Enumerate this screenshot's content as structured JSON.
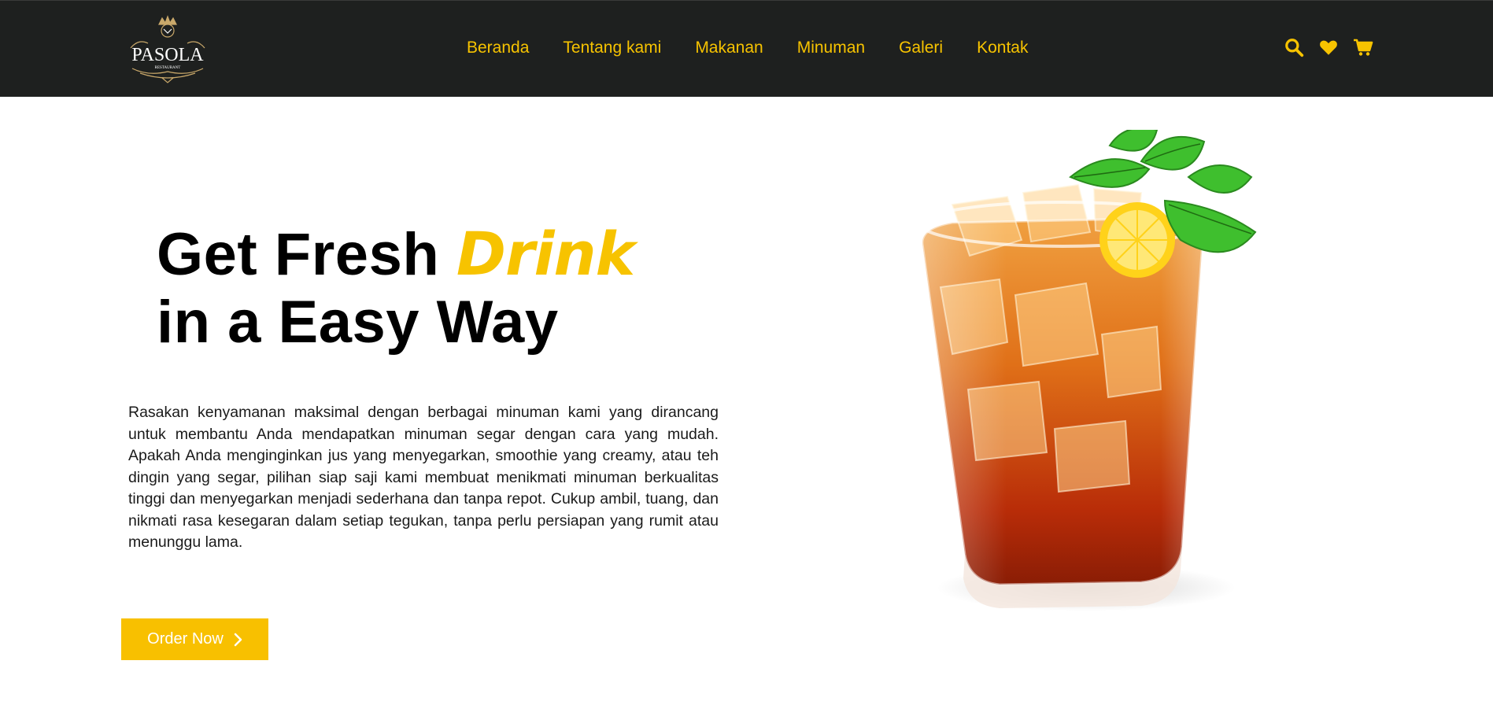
{
  "brand": {
    "logo_text": "PASOLA",
    "logo_subtext": "RESTAURANT"
  },
  "nav": {
    "items": [
      {
        "label": "Beranda"
      },
      {
        "label": "Tentang kami"
      },
      {
        "label": "Makanan"
      },
      {
        "label": "Minuman"
      },
      {
        "label": "Galeri"
      },
      {
        "label": "Kontak"
      }
    ]
  },
  "icons": {
    "search": "search-icon",
    "favorite": "heart-icon",
    "cart": "cart-icon"
  },
  "hero": {
    "title_part1": "Get Fresh ",
    "title_accent": "Drink",
    "title_line2": "in a Easy Way",
    "description": "Rasakan kenyamanan maksimal dengan berbagai minuman kami yang dirancang untuk membantu Anda mendapatkan minuman segar dengan cara yang mudah. Apakah Anda menginginkan jus yang menyegarkan, smoothie yang creamy, atau teh dingin yang segar, pilihan siap saji kami membuat menikmati minuman berkualitas tinggi dan menyegarkan menjadi sederhana dan tanpa repot. Cukup ambil, tuang, dan nikmati rasa kesegaran dalam setiap tegukan, tanpa perlu persiapan yang rumit atau menunggu lama.",
    "cta_label": "Order Now"
  },
  "colors": {
    "accent": "#f7c300",
    "navbar_bg": "#1e201f",
    "text": "#000000"
  }
}
